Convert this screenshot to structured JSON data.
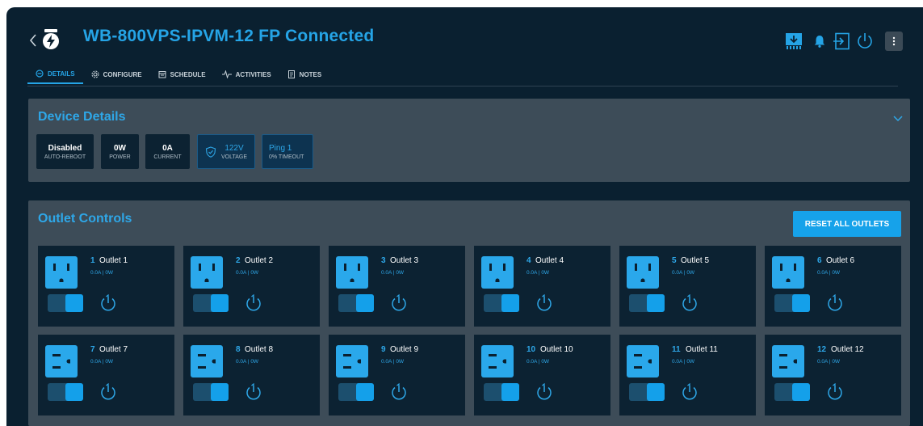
{
  "header": {
    "title": "WB-800VPS-IPVM-12 FP Connected",
    "icons": [
      "back-chevron-icon",
      "device-logo-icon",
      "download-firmware-icon",
      "bell-icon",
      "login-icon",
      "power-icon",
      "more-vertical-icon"
    ]
  },
  "tabs": [
    {
      "label": "DETAILS",
      "icon": "settings-circle-icon",
      "active": true
    },
    {
      "label": "CONFIGURE",
      "icon": "gear-icon",
      "active": false
    },
    {
      "label": "SCHEDULE",
      "icon": "calendar-icon",
      "active": false
    },
    {
      "label": "ACTIVITIES",
      "icon": "pulse-icon",
      "active": false
    },
    {
      "label": "NOTES",
      "icon": "note-icon",
      "active": false
    }
  ],
  "device_details": {
    "title": "Device Details",
    "stats": [
      {
        "value": "Disabled",
        "label": "AUTO-REBOOT"
      },
      {
        "value": "0W",
        "label": "POWER"
      },
      {
        "value": "0A",
        "label": "CURRENT"
      },
      {
        "value": "122V",
        "label": "VOLTAGE",
        "icon": "shield-check-icon"
      },
      {
        "value": "Ping 1",
        "label": "0% TIMEOUT"
      }
    ]
  },
  "outlet_controls": {
    "title": "Outlet Controls",
    "reset_label": "RESET ALL OUTLETS",
    "outlets": [
      {
        "num": "1",
        "name": "Outlet 1",
        "meta": "0.0A | 0W",
        "on": true,
        "style": "vertical"
      },
      {
        "num": "2",
        "name": "Outlet 2",
        "meta": "0.0A | 0W",
        "on": true,
        "style": "vertical"
      },
      {
        "num": "3",
        "name": "Outlet 3",
        "meta": "0.0A | 0W",
        "on": true,
        "style": "vertical"
      },
      {
        "num": "4",
        "name": "Outlet 4",
        "meta": "0.0A | 0W",
        "on": true,
        "style": "vertical"
      },
      {
        "num": "5",
        "name": "Outlet 5",
        "meta": "0.0A | 0W",
        "on": true,
        "style": "vertical"
      },
      {
        "num": "6",
        "name": "Outlet 6",
        "meta": "0.0A | 0W",
        "on": true,
        "style": "vertical"
      },
      {
        "num": "7",
        "name": "Outlet 7",
        "meta": "0.0A | 0W",
        "on": true,
        "style": "horizontal"
      },
      {
        "num": "8",
        "name": "Outlet 8",
        "meta": "0.0A | 0W",
        "on": true,
        "style": "horizontal"
      },
      {
        "num": "9",
        "name": "Outlet 9",
        "meta": "0.0A | 0W",
        "on": true,
        "style": "horizontal"
      },
      {
        "num": "10",
        "name": "Outlet 10",
        "meta": "0.0A | 0W",
        "on": true,
        "style": "horizontal"
      },
      {
        "num": "11",
        "name": "Outlet 11",
        "meta": "0.0A | 0W",
        "on": true,
        "style": "horizontal"
      },
      {
        "num": "12",
        "name": "Outlet 12",
        "meta": "0.0A | 0W",
        "on": true,
        "style": "horizontal"
      }
    ]
  },
  "colors": {
    "background": "#0a2030",
    "panel": "#3d4c58",
    "card": "#0c2232",
    "accent": "#25a4e6",
    "button": "#16a2ea"
  }
}
